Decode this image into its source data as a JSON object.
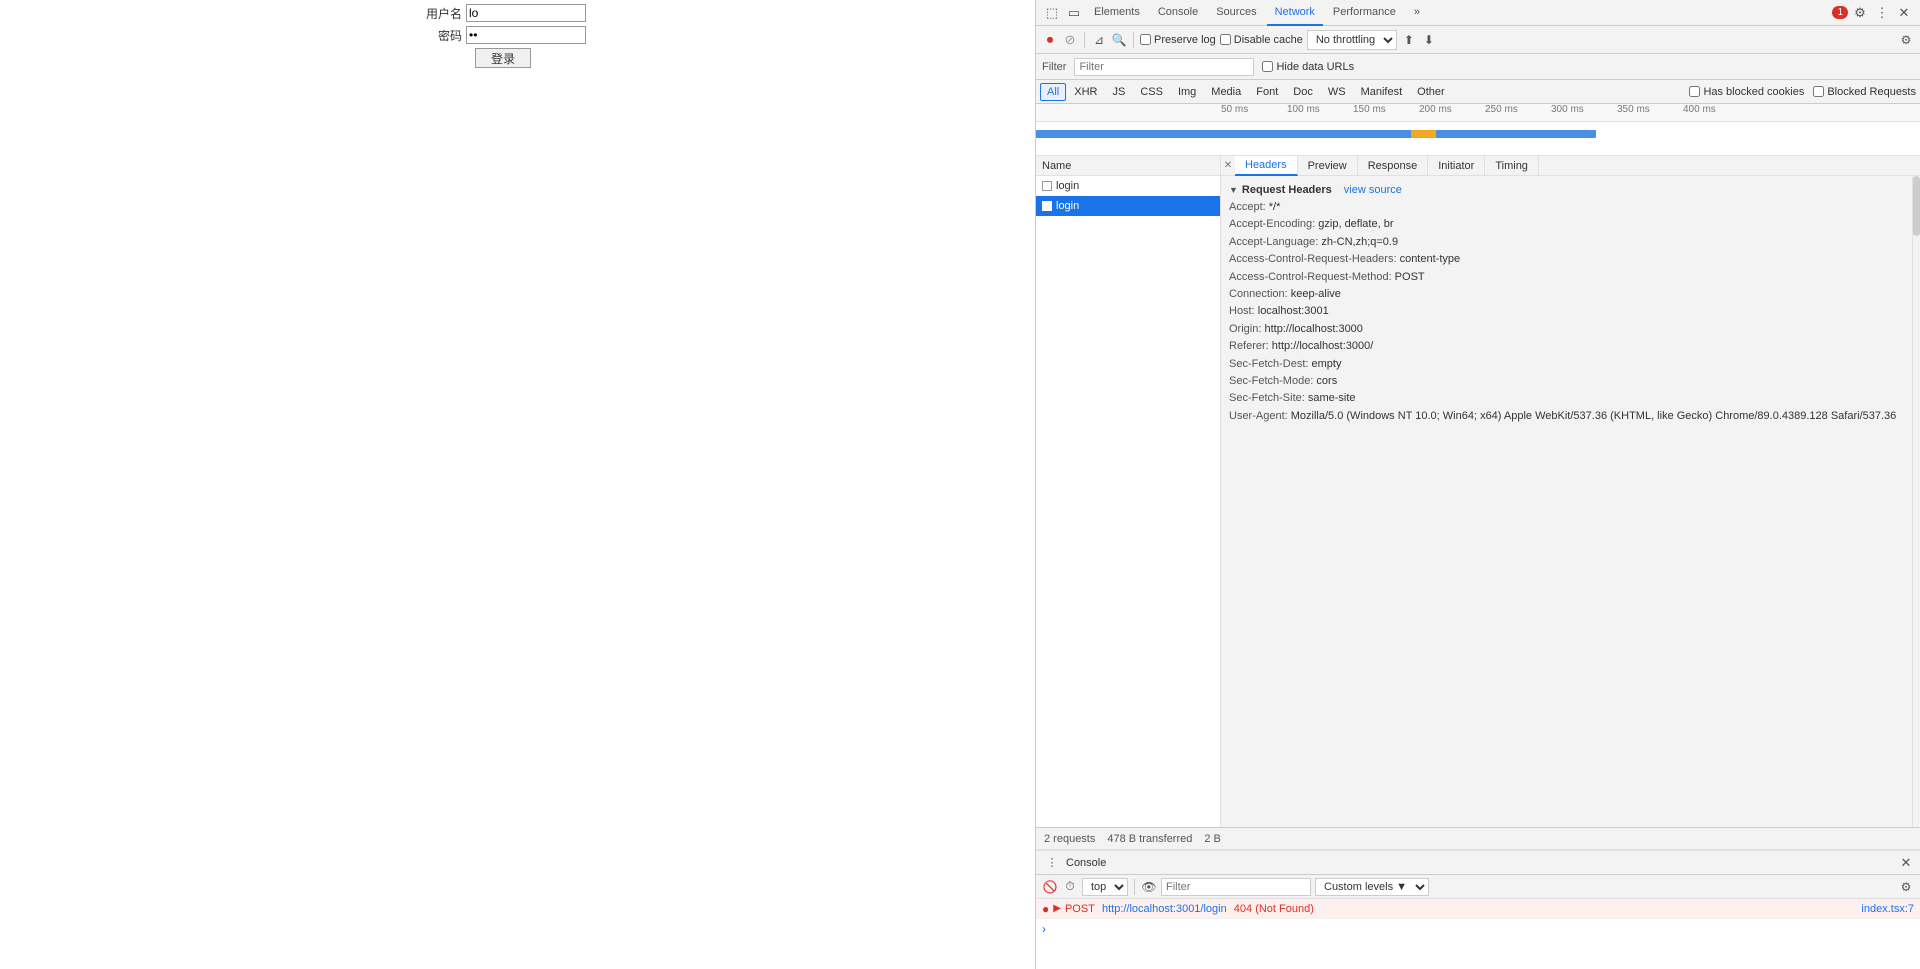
{
  "page": {
    "background": "#ffffff"
  },
  "login_form": {
    "username_label": "用户名",
    "password_label": "密码",
    "username_value": "lo",
    "password_value": "..",
    "submit_label": "登录"
  },
  "devtools": {
    "tabs": [
      {
        "label": "Elements",
        "active": false
      },
      {
        "label": "Console",
        "active": false
      },
      {
        "label": "Sources",
        "active": false
      },
      {
        "label": "Network",
        "active": true
      },
      {
        "label": "Performance",
        "active": false
      },
      {
        "label": "»",
        "active": false
      }
    ],
    "error_count": "1",
    "network": {
      "toolbar": {
        "preserve_log_label": "Preserve log",
        "disable_cache_label": "Disable cache",
        "no_throttling_label": "No throttling",
        "filter_placeholder": "Filter",
        "hide_data_urls_label": "Hide data URLs"
      },
      "type_filters": [
        {
          "label": "All",
          "active": true
        },
        {
          "label": "XHR"
        },
        {
          "label": "JS"
        },
        {
          "label": "CSS"
        },
        {
          "label": "Img"
        },
        {
          "label": "Media"
        },
        {
          "label": "Font"
        },
        {
          "label": "Doc"
        },
        {
          "label": "WS"
        },
        {
          "label": "Manifest"
        },
        {
          "label": "Other"
        }
      ],
      "has_blocked_cookies_label": "Has blocked cookies",
      "blocked_requests_label": "Blocked Requests",
      "timeline_ticks": [
        "50 ms",
        "100 ms",
        "150 ms",
        "200 ms",
        "250 ms",
        "300 ms",
        "350 ms",
        "400 ms"
      ],
      "name_column_header": "Name",
      "requests": [
        {
          "name": "login",
          "selected": false
        },
        {
          "name": "login",
          "selected": true
        }
      ],
      "headers_panel": {
        "tabs": [
          "Headers",
          "Preview",
          "Response",
          "Initiator",
          "Timing"
        ],
        "active_tab": "Headers",
        "section_title": "Request Headers",
        "view_source_label": "view source",
        "headers": [
          {
            "name": "Accept:",
            "value": " */*"
          },
          {
            "name": "Accept-Encoding:",
            "value": " gzip, deflate, br"
          },
          {
            "name": "Accept-Language:",
            "value": " zh-CN,zh;q=0.9"
          },
          {
            "name": "Access-Control-Request-Headers:",
            "value": " content-type"
          },
          {
            "name": "Access-Control-Request-Method:",
            "value": " POST"
          },
          {
            "name": "Connection:",
            "value": " keep-alive"
          },
          {
            "name": "Host:",
            "value": " localhost:3001"
          },
          {
            "name": "Origin:",
            "value": " http://localhost:3000"
          },
          {
            "name": "Referer:",
            "value": " http://localhost:3000/"
          },
          {
            "name": "Sec-Fetch-Dest:",
            "value": " empty"
          },
          {
            "name": "Sec-Fetch-Mode:",
            "value": " cors"
          },
          {
            "name": "Sec-Fetch-Site:",
            "value": " same-site"
          },
          {
            "name": "User-Agent:",
            "value": " Mozilla/5.0 (Windows NT 10.0; Win64; x64) Apple WebKit/537.36 (KHTML, like Gecko) Chrome/89.0.4389.128 Safari/537.36"
          }
        ]
      },
      "status_bar": {
        "requests": "2 requests",
        "transferred": "478 B transferred",
        "extra": "2 B"
      }
    },
    "console": {
      "title": "Console",
      "toolbar": {
        "top_label": "top",
        "filter_placeholder": "Filter",
        "custom_levels_label": "Custom levels ▼"
      },
      "rows": [
        {
          "type": "error",
          "arrow": "▶",
          "method": "POST",
          "url": "http://localhost:3001/login",
          "status": "404 (Not Found)",
          "file": "index.tsx:7"
        }
      ],
      "prompt_arrow": ">"
    }
  }
}
